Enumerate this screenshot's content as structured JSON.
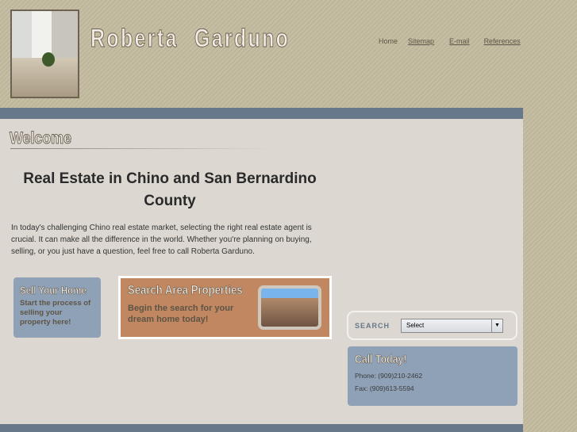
{
  "header": {
    "site_title": "Roberta Garduno",
    "nav": [
      "Home",
      "Sitemap",
      "E-mail",
      "References"
    ]
  },
  "main": {
    "welcome": "Welcome",
    "heading": "Real Estate in Chino and San Bernardino County",
    "intro": "In today's challenging Chino real estate market, selecting the right real estate agent is crucial. It can make all the difference in the world. Whether you're planning on buying, selling, or you just have a question, feel free to call Roberta Garduno."
  },
  "sell_banner": {
    "title": "Sell Your Home",
    "text": "Start the process of selling your property here!"
  },
  "search_banner": {
    "title": "Search Area Properties",
    "text": "Begin the search for your dream home today!"
  },
  "search": {
    "label": "SEARCH",
    "selected": "Select"
  },
  "call": {
    "title": "Call Today!",
    "phone": "Phone: (909)210-2462",
    "fax": "Fax: (909)613-5594"
  }
}
